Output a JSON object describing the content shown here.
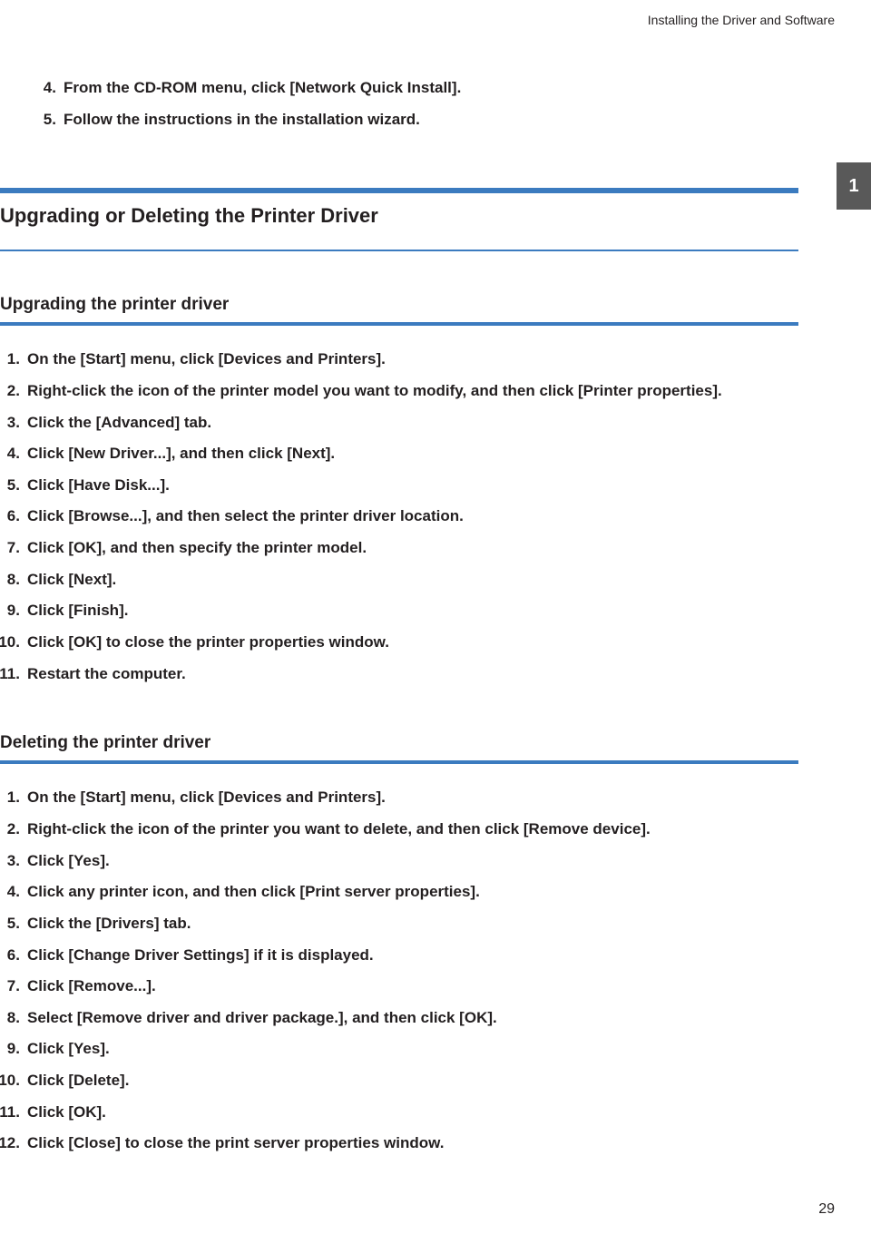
{
  "running_head": "Installing the Driver and Software",
  "tab_number": "1",
  "page_number": "29",
  "intro_steps_start": 3,
  "intro_steps": [
    "From the CD-ROM menu, click [Network Quick Install].",
    "Follow the instructions in the installation wizard."
  ],
  "section_title": "Upgrading or Deleting the Printer Driver",
  "subsections": [
    {
      "title": "Upgrading the printer driver",
      "steps": [
        "On the [Start] menu, click [Devices and Printers].",
        "Right-click the icon of the printer model you want to modify, and then click [Printer properties].",
        "Click the [Advanced] tab.",
        "Click [New Driver...], and then click [Next].",
        "Click [Have Disk...].",
        "Click [Browse...], and then select the printer driver location.",
        "Click [OK], and then specify the printer model.",
        "Click [Next].",
        "Click [Finish].",
        "Click [OK] to close the printer properties window.",
        "Restart the computer."
      ]
    },
    {
      "title": "Deleting the printer driver",
      "steps": [
        "On the [Start] menu, click [Devices and Printers].",
        "Right-click the icon of the printer you want to delete, and then click [Remove device].",
        "Click [Yes].",
        "Click any printer icon, and then click [Print server properties].",
        "Click the [Drivers] tab.",
        "Click [Change Driver Settings] if it is displayed.",
        "Click [Remove...].",
        "Select [Remove driver and driver package.], and then click [OK].",
        "Click [Yes].",
        "Click [Delete].",
        "Click [OK].",
        "Click [Close] to close the print server properties window."
      ]
    }
  ]
}
